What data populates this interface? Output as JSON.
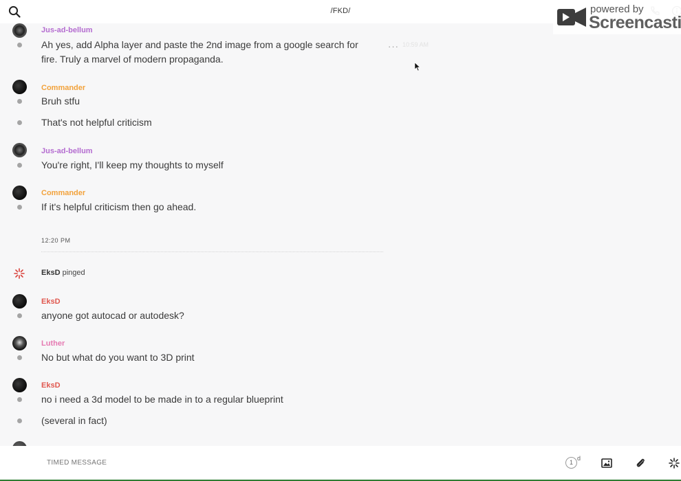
{
  "header": {
    "channel_title": "/FKD/"
  },
  "watermark": {
    "powered_by": "powered by",
    "brand": "Screencastify"
  },
  "colors": {
    "jus": "#b46cd0",
    "commander": "#f2a23b",
    "eksd": "#e0584f",
    "luther": "#e57ab2"
  },
  "messages": [
    {
      "user": "Jus-ad-bellum",
      "lines": [
        "Ah yes, add Alpha layer and paste the 2nd image from a google search for fire. Truly a marvel of modern propaganda."
      ],
      "time": "10:59 AM"
    },
    {
      "user": "Commander",
      "lines": [
        "Bruh stfu",
        "That's not helpful criticism"
      ]
    },
    {
      "user": "Jus-ad-bellum",
      "lines": [
        "You're right, I'll keep my thoughts to myself"
      ]
    },
    {
      "user": "Commander",
      "lines": [
        "If it's helpful criticism then go ahead."
      ]
    },
    {
      "user": "EksD",
      "lines": [
        "anyone got autocad or autodesk?"
      ]
    },
    {
      "user": "Luther",
      "lines": [
        "No but what do you want to 3D print"
      ]
    },
    {
      "user": "EksD",
      "lines": [
        "no i need a 3d model to be made in to a regular blueprint",
        "(several in fact)"
      ]
    }
  ],
  "divider_time": "12:20 PM",
  "ping": {
    "user": "EksD",
    "action": "pinged"
  },
  "more_glyph": "···",
  "composer": {
    "placeholder": "TIMED MESSAGE",
    "timer_value": "1",
    "timer_unit": "d"
  }
}
